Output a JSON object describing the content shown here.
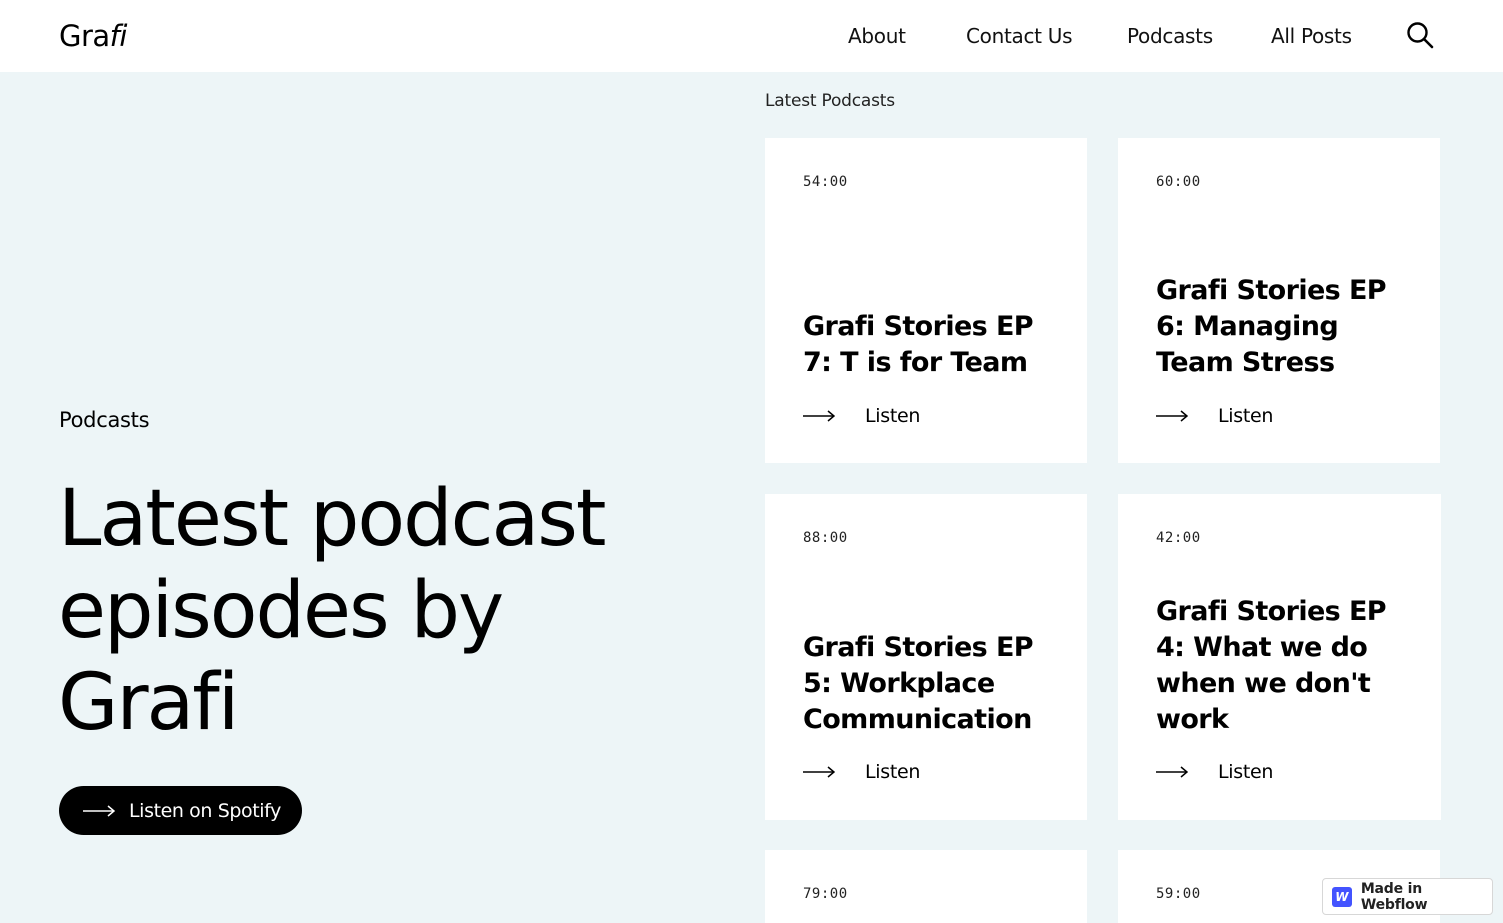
{
  "header": {
    "logo_main": "Gra",
    "logo_italic": "fi",
    "nav": [
      {
        "label": "About"
      },
      {
        "label": "Contact Us"
      },
      {
        "label": "Podcasts"
      },
      {
        "label": "All Posts"
      }
    ],
    "search_icon": "search-icon"
  },
  "hero": {
    "eyebrow": "Podcasts",
    "title": "Latest podcast episodes by Grafi",
    "cta_label": "Listen on Spotify"
  },
  "latest": {
    "section_label": "Latest Podcasts",
    "cards": [
      {
        "duration": "54:00",
        "title": "Grafi Stories EP 7: T is for Team",
        "listen": "Listen"
      },
      {
        "duration": "60:00",
        "title": "Grafi Stories EP 6: Managing Team Stress",
        "listen": "Listen"
      },
      {
        "duration": "88:00",
        "title": "Grafi Stories EP 5: Workplace Communication",
        "listen": "Listen"
      },
      {
        "duration": "42:00",
        "title": "Grafi Stories EP 4: What we do when we don't work",
        "listen": "Listen"
      },
      {
        "duration": "79:00",
        "title": "",
        "listen": ""
      },
      {
        "duration": "59:00",
        "title": "",
        "listen": ""
      }
    ]
  },
  "badge": {
    "icon_letter": "W",
    "label": "Made in Webflow",
    "brand_color": "#4353ff"
  },
  "colors": {
    "page_bg": "#edf5f7",
    "header_bg": "#ffffff",
    "card_bg": "#ffffff",
    "button_bg": "#000000"
  }
}
